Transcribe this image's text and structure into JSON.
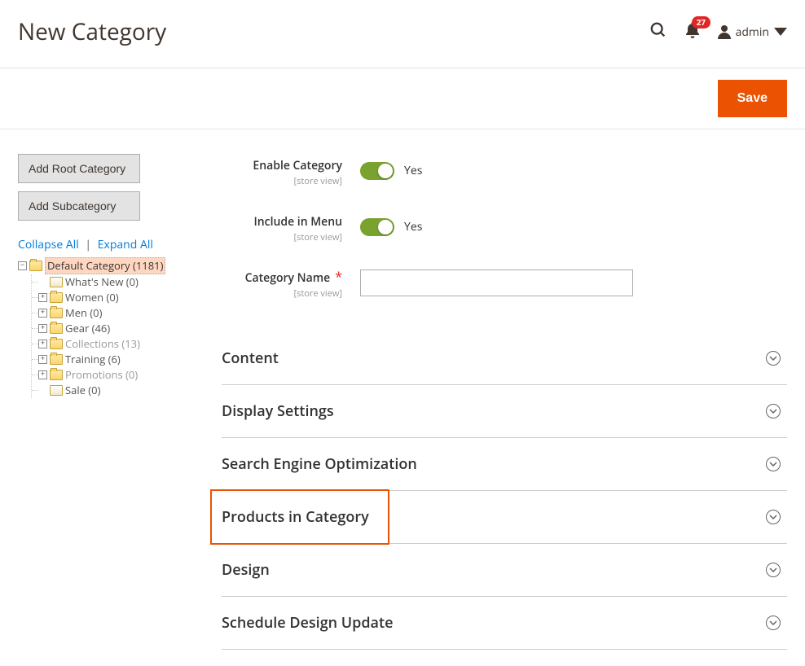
{
  "header": {
    "title": "New Category",
    "notif_count": "27",
    "admin_label": "admin"
  },
  "actions": {
    "save": "Save"
  },
  "sidebar": {
    "add_root": "Add Root Category",
    "add_sub": "Add Subcategory",
    "collapse_all": "Collapse All",
    "expand_all": "Expand All",
    "root": {
      "label": "Default Category (1181)",
      "children": [
        {
          "label": "What's New (0)",
          "expandable": false,
          "disabled": false
        },
        {
          "label": "Women (0)",
          "expandable": true,
          "disabled": false
        },
        {
          "label": "Men (0)",
          "expandable": true,
          "disabled": false
        },
        {
          "label": "Gear (46)",
          "expandable": true,
          "disabled": false
        },
        {
          "label": "Collections (13)",
          "expandable": true,
          "disabled": true
        },
        {
          "label": "Training (6)",
          "expandable": true,
          "disabled": false
        },
        {
          "label": "Promotions (0)",
          "expandable": true,
          "disabled": true
        },
        {
          "label": "Sale (0)",
          "expandable": false,
          "disabled": false
        }
      ]
    }
  },
  "form": {
    "enable_label": "Enable Category",
    "scope": "[store view]",
    "include_label": "Include in Menu",
    "name_label": "Category Name",
    "yes": "Yes"
  },
  "sections": [
    "Content",
    "Display Settings",
    "Search Engine Optimization",
    "Products in Category",
    "Design",
    "Schedule Design Update"
  ],
  "highlighted_section_index": 3
}
